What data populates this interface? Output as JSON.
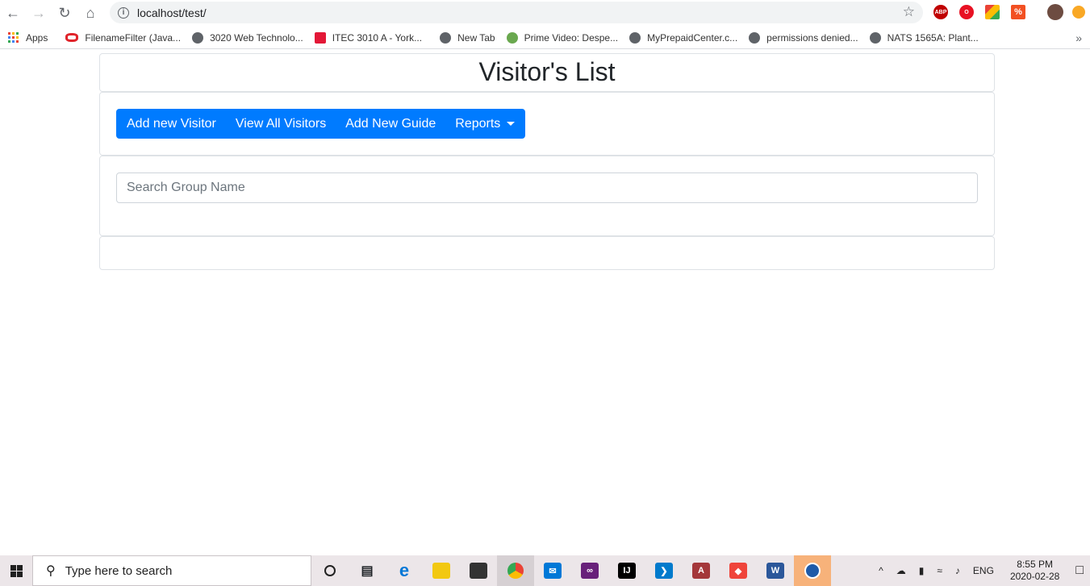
{
  "browser": {
    "url": "localhost/test/",
    "bookmarks": [
      {
        "label": "Apps",
        "icon": "apps-grid-icon"
      },
      {
        "label": "FilenameFilter (Java...",
        "icon": "oracle-icon",
        "color": "#e0242b"
      },
      {
        "label": "3020 Web Technolo...",
        "icon": "globe-icon",
        "color": "#5f6368"
      },
      {
        "label": "ITEC 3010 A - York...",
        "icon": "york-icon",
        "color": "#e31837"
      },
      {
        "label": "New Tab",
        "icon": "globe-icon",
        "color": "#5f6368"
      },
      {
        "label": "Prime Video: Despe...",
        "icon": "prime-video-icon",
        "color": "#6aa84f"
      },
      {
        "label": "MyPrepaidCenter.c...",
        "icon": "globe-icon",
        "color": "#5f6368"
      },
      {
        "label": "permissions denied...",
        "icon": "globe-icon",
        "color": "#5f6368"
      },
      {
        "label": "NATS 1565A: Plant...",
        "icon": "globe-icon",
        "color": "#5f6368"
      }
    ],
    "extensions": [
      {
        "name": "abp-icon",
        "label": "ABP",
        "color": "#c00000"
      },
      {
        "name": "opera-icon",
        "label": "O",
        "color": "#e81123"
      },
      {
        "name": "colorful-ext-icon",
        "label": "",
        "color": "#f4b400"
      },
      {
        "name": "percent-ext-icon",
        "label": "%",
        "color": "#f25022"
      },
      {
        "name": "profile-avatar",
        "label": "",
        "color": "#6d4c41"
      },
      {
        "name": "update-icon",
        "label": "",
        "color": "#f9a825"
      }
    ]
  },
  "page": {
    "title": "Visitor's List",
    "nav": {
      "items": [
        "Add new Visitor",
        "View All Visitors",
        "Add New Guide"
      ],
      "dropdown_label": "Reports",
      "bg_color": "#007bff"
    },
    "search": {
      "placeholder": "Search Group Name",
      "value": ""
    }
  },
  "taskbar": {
    "search_placeholder": "Type here to search",
    "language": "ENG",
    "time": "8:55 PM",
    "date": "2020-02-28"
  }
}
